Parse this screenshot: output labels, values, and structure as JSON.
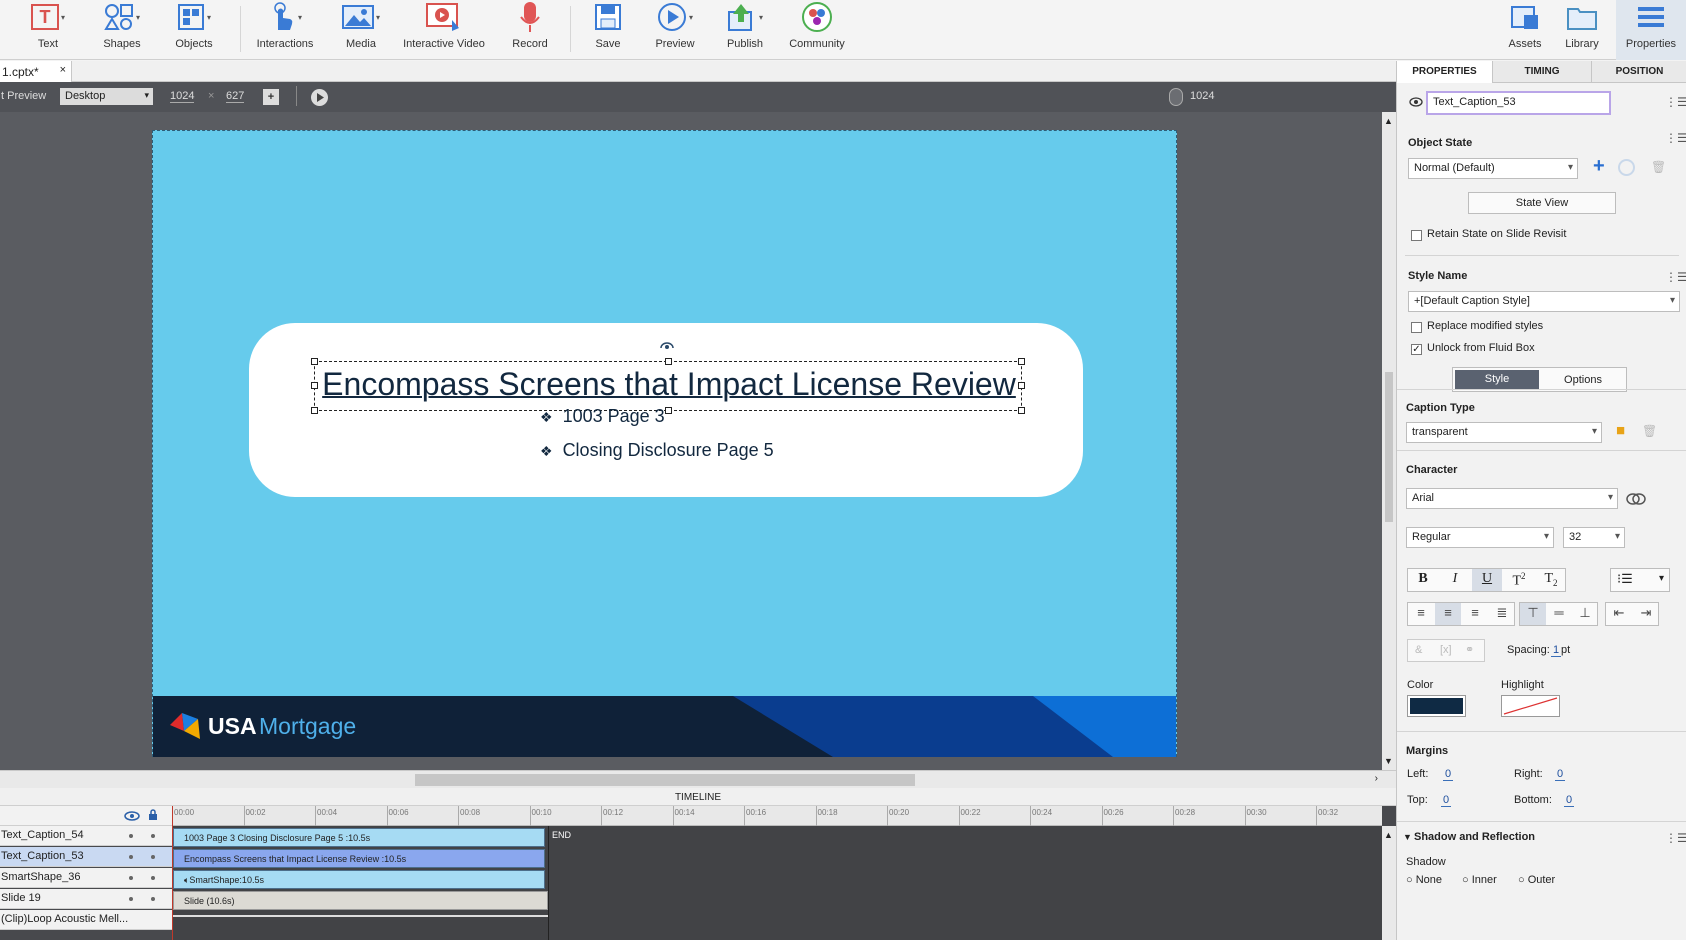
{
  "toolbar": {
    "items": [
      {
        "label": "Text",
        "icon": "text-icon"
      },
      {
        "label": "Shapes",
        "icon": "shapes-icon"
      },
      {
        "label": "Objects",
        "icon": "objects-icon"
      },
      {
        "label": "Interactions",
        "icon": "interactions-icon"
      },
      {
        "label": "Media",
        "icon": "media-icon"
      },
      {
        "label": "Interactive Video",
        "icon": "interactive-video-icon"
      },
      {
        "label": "Record",
        "icon": "record-icon"
      },
      {
        "label": "Save",
        "icon": "save-icon"
      },
      {
        "label": "Preview",
        "icon": "preview-icon"
      },
      {
        "label": "Publish",
        "icon": "publish-icon"
      },
      {
        "label": "Community",
        "icon": "community-icon"
      },
      {
        "label": "Assets",
        "icon": "assets-icon"
      },
      {
        "label": "Library",
        "icon": "library-icon"
      },
      {
        "label": "Properties",
        "icon": "properties-icon"
      }
    ]
  },
  "doc_tab": {
    "name": "1.cptx*",
    "close": "×"
  },
  "preview_bar": {
    "label": "t Preview",
    "device": "Desktop",
    "width": "1024",
    "times": "×",
    "height": "627",
    "ruler_value": "1024"
  },
  "slide": {
    "title": "Encompass Screens that Impact License Review",
    "bullets": [
      "1003 Page 3",
      "Closing Disclosure Page 5"
    ],
    "bullet_glyph": "❖",
    "logo_bold": "USA",
    "logo_light": "Mortgage",
    "bg_color": "#66cbec"
  },
  "timeline": {
    "header": "TIMELINE",
    "ticks": [
      "00:00",
      "00:02",
      "00:04",
      "00:06",
      "00:08",
      "00:10",
      "00:12",
      "00:14",
      "00:16",
      "00:18",
      "00:20",
      "00:22",
      "00:24",
      "00:26",
      "00:28",
      "00:30",
      "00:32"
    ],
    "end_label": "END",
    "layers": [
      {
        "name": "Text_Caption_54",
        "bar": "1003 Page 3 Closing Disclosure Page 5 :10.5s",
        "selected": false
      },
      {
        "name": "Text_Caption_53",
        "bar": "Encompass Screens that Impact License Review   :10.5s",
        "selected": true
      },
      {
        "name": "SmartShape_36",
        "bar": "SmartShape:10.5s",
        "selected": false
      },
      {
        "name": "Slide 19",
        "bar": "Slide (10.6s)",
        "selected": false
      },
      {
        "name": "(Clip)Loop Acoustic Mell...",
        "bar": "",
        "selected": false
      }
    ]
  },
  "properties": {
    "tabs": [
      "PROPERTIES",
      "TIMING",
      "POSITION"
    ],
    "object_name": "Text_Caption_53",
    "object_state_heading": "Object State",
    "state_value": "Normal (Default)",
    "state_view_btn": "State View",
    "retain_state": "Retain State on Slide Revisit",
    "style_name_heading": "Style Name",
    "style_name_value": "+[Default Caption Style]",
    "replace_styles": "Replace modified styles",
    "unlock_fluid": "Unlock from Fluid Box",
    "subtabs": [
      "Style",
      "Options"
    ],
    "caption_type_heading": "Caption Type",
    "caption_type_value": "transparent",
    "character_heading": "Character",
    "font": "Arial",
    "font_style": "Regular",
    "font_size": "32",
    "spacing_label": "Spacing:",
    "spacing_value": "1",
    "spacing_unit": "pt",
    "color_label": "Color",
    "highlight_label": "Highlight",
    "color_value": "#0f2a44",
    "margins_heading": "Margins",
    "left_label": "Left:",
    "right_label": "Right:",
    "top_label": "Top:",
    "bottom_label": "Bottom:",
    "left_value": "0",
    "right_value": "0",
    "top_value": "0",
    "bottom_value": "0",
    "shadow_heading": "Shadow and Reflection",
    "shadow_label": "Shadow",
    "shadow_options": [
      "None",
      "Inner",
      "Outer"
    ]
  }
}
